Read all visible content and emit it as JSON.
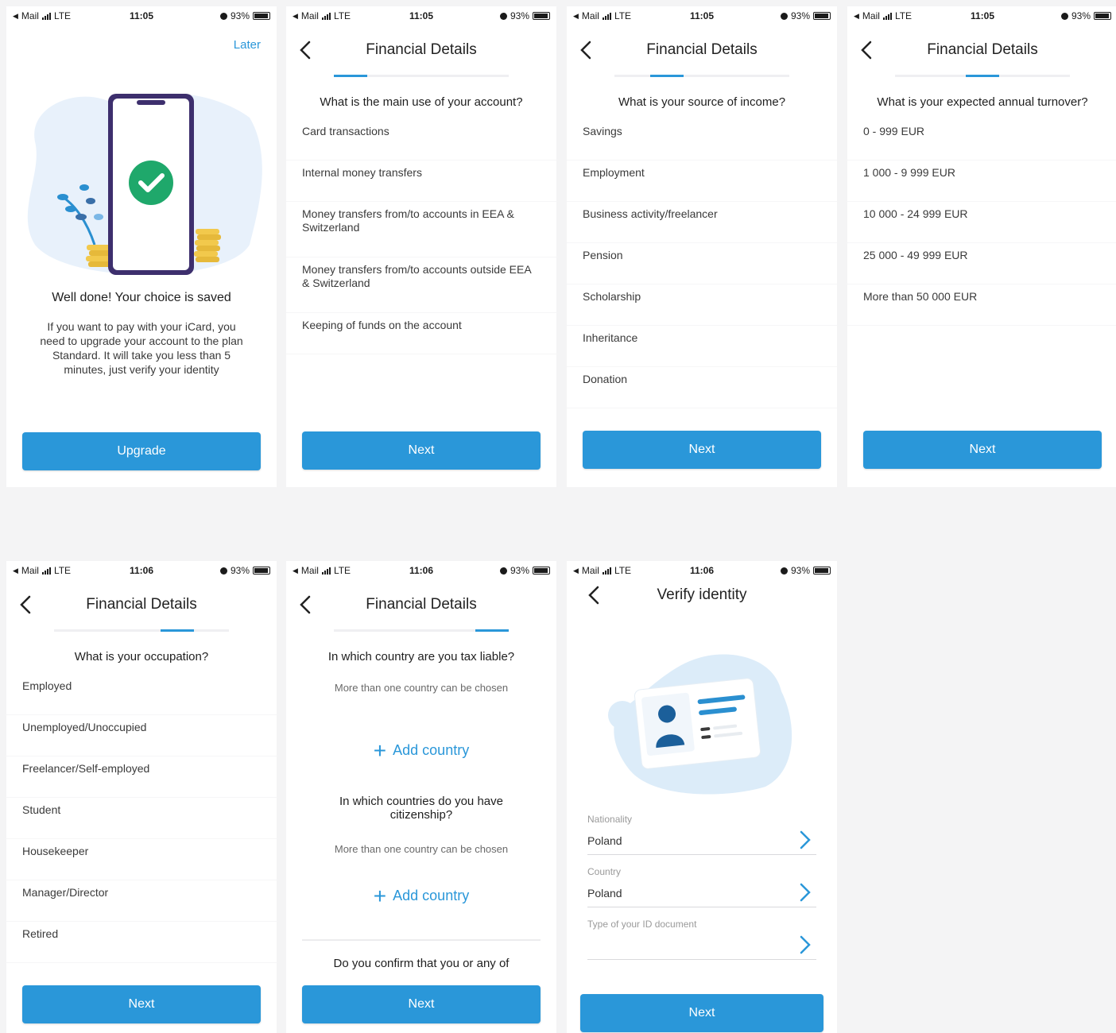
{
  "status": [
    {
      "carrier": "Mail",
      "network": "LTE",
      "time": "11:05",
      "battery": "93%"
    },
    {
      "carrier": "Mail",
      "network": "LTE",
      "time": "11:05",
      "battery": "93%"
    },
    {
      "carrier": "Mail",
      "network": "LTE",
      "time": "11:05",
      "battery": "93%"
    },
    {
      "carrier": "Mail",
      "network": "LTE",
      "time": "11:05",
      "battery": "93%"
    },
    {
      "carrier": "Mail",
      "network": "LTE",
      "time": "11:06",
      "battery": "93%"
    },
    {
      "carrier": "Mail",
      "network": "LTE",
      "time": "11:06",
      "battery": "93%"
    },
    {
      "carrier": "Mail",
      "network": "LTE",
      "time": "11:06",
      "battery": "93%"
    }
  ],
  "colors": {
    "accent": "#2a97d9",
    "success": "#1fa86b",
    "phone_frame": "#3d2f6d",
    "coin": "#f2c94c",
    "plant": "#2a8fd0"
  },
  "screen1": {
    "later": "Later",
    "title": "Well done! Your choice is saved",
    "body": "If you want to pay with your iCard, you need to upgrade your account to the plan Standard. It will take you less than 5 minutes, just verify your identity",
    "button": "Upgrade",
    "icons": [
      "phone-illustration",
      "check-circle-icon",
      "coins",
      "plant"
    ]
  },
  "screen2": {
    "title": "Financial Details",
    "question": "What is the main use of your account?",
    "options": [
      "Card transactions",
      "Internal money transfers",
      "Money transfers from/to accounts in EEA & Switzerland",
      "Money transfers from/to accounts outside EEA & Switzerland",
      "Keeping of funds on the account"
    ],
    "button": "Next",
    "step": 0.0
  },
  "screen3": {
    "title": "Financial Details",
    "question": "What is your source of income?",
    "options": [
      "Savings",
      "Employment",
      "Business activity/freelancer",
      "Pension",
      "Scholarship",
      "Inheritance",
      "Donation"
    ],
    "button": "Next",
    "step": 0.25
  },
  "screen4": {
    "title": "Financial Details",
    "question": "What is your expected annual turnover?",
    "options": [
      "0 - 999 EUR",
      "1 000 - 9 999 EUR",
      "10 000 - 24 999 EUR",
      "25 000 - 49 999 EUR",
      "More than 50 000 EUR"
    ],
    "button": "Next",
    "step": 0.5
  },
  "screen5": {
    "title": "Financial Details",
    "question": "What is your occupation?",
    "options": [
      "Employed",
      "Unemployed/Unoccupied",
      "Freelancer/Self-employed",
      "Student",
      "Housekeeper",
      "Manager/Director",
      "Retired"
    ],
    "button": "Next",
    "step": 0.75
  },
  "screen6": {
    "title": "Financial Details",
    "q1": "In which country are you tax liable?",
    "hint1": "More than one country can be chosen",
    "add1": "Add country",
    "q2": "In which countries do you have citizenship?",
    "hint2": "More than one country can be chosen",
    "add2": "Add country",
    "q3": "Do you confirm that you or any of",
    "button": "Next",
    "step": 1.0
  },
  "screen7": {
    "title": "Verify identity",
    "nationality_label": "Nationality",
    "nationality_value": "Poland",
    "country_label": "Country",
    "country_value": "Poland",
    "document_label": "Type of your ID document",
    "document_value": "",
    "button": "Next",
    "icons": [
      "id-card-illustration",
      "chevron-right-icon"
    ]
  }
}
